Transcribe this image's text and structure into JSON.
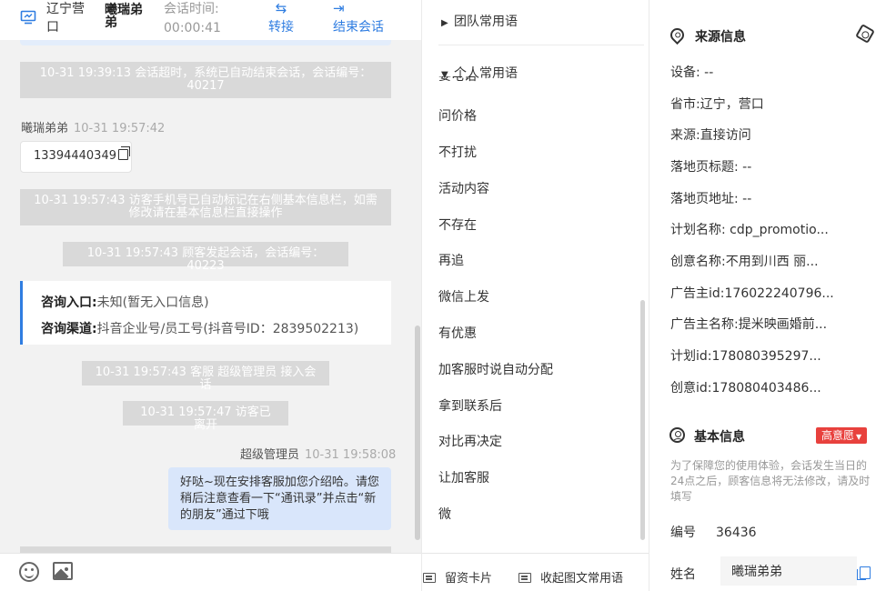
{
  "header": {
    "location": "辽宁营口",
    "visitor_name": "曦瑞弟弟",
    "session_time_label": "会话时间:",
    "session_time": "00:00:41",
    "transfer_label": "转接",
    "end_session_label": "结束会话"
  },
  "chat": {
    "sys_msg_1": "10-31 19:39:13 会话超时，系统已自动结束会话，会话编号：40217",
    "visitor_sender": "曦瑞弟弟",
    "visitor_time": "10-31 19:57:42",
    "visitor_phone": "13394440349",
    "sys_msg_2": "10-31 19:57:43 访客手机号已自动标记在右侧基本信息栏，如需修改请在基本信息栏直接操作",
    "sys_msg_3": "10-31 19:57:43 顾客发起会话，会话编号：40223",
    "entry_label": "咨询入口:",
    "entry_value": "未知(暂无入口信息)",
    "channel_label": "咨询渠道:",
    "channel_value": "抖音企业号/员工号(抖音号ID：2839502213)",
    "sys_msg_4": "10-31 19:57:43 客服 超级管理员 接入会话",
    "sys_msg_5": "10-31 19:57:47 访客已离开",
    "agent_sender": "超级管理员",
    "agent_time": "10-31 19:58:08",
    "agent_message": "好哒~现在安排客服加您介绍哈。请您稍后注意查看一下“通讯录”并点击“新的朋友”通过下哦"
  },
  "phrases": {
    "team_group": "团队常用语",
    "personal_group": "个人常用语",
    "clipped_item": "要电话",
    "items": [
      "问价格",
      "不打扰",
      "活动内容",
      "不存在",
      "再追",
      "微信上发",
      "有优惠",
      "加客服时说自动分配",
      "拿到联系后",
      "对比再决定",
      "让加客服",
      "微"
    ],
    "card_button": "留资卡片",
    "collapse_button": "收起图文常用语"
  },
  "source_info": {
    "title": "来源信息",
    "fields": [
      {
        "label": "设备:",
        "value": "--"
      },
      {
        "label": "省市:",
        "value": "辽宁，营口"
      },
      {
        "label": "来源:",
        "value": "直接访问"
      },
      {
        "label": "落地页标题:",
        "value": "--"
      },
      {
        "label": "落地页地址:",
        "value": "--"
      },
      {
        "label": "计划名称:",
        "value": "cdp_promotio..."
      },
      {
        "label": "创意名称:",
        "value": "不用到川西 丽..."
      },
      {
        "label": "广告主id:",
        "value": "176022240796..."
      },
      {
        "label": "广告主名称:",
        "value": "提米映画婚前..."
      },
      {
        "label": "计划id:",
        "value": "178080395297..."
      },
      {
        "label": "创意id:",
        "value": "178080403486..."
      }
    ]
  },
  "basic_info": {
    "title": "基本信息",
    "intent_badge": "高意愿",
    "notice": "为了保障您的使用体验，会话发生当日的24点之后，顾客信息将无法修改，请及时填写",
    "id_label": "编号",
    "id_value": "36436",
    "name_label": "姓名",
    "name_value": "曦瑞弟弟"
  },
  "colors": {
    "accent": "#2f7de1",
    "badge": "#e8413d",
    "system_bubble": "#d9d9d9",
    "agent_bubble": "#d9e6fb"
  }
}
